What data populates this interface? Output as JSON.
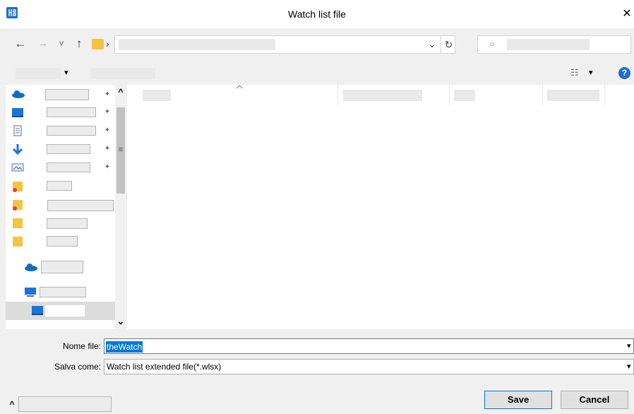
{
  "window": {
    "title": "Watch list file",
    "close_glyph": "✕",
    "app_icon": "app-logo-icon"
  },
  "nav": {
    "back": "←",
    "forward": "→",
    "recent": "˅",
    "up": "↑",
    "crumb_sep": "›",
    "address_dropdown": "⌄",
    "refresh": "↻",
    "search_glyph": "⌕"
  },
  "toolbar": {
    "view_glyph": "☷",
    "dropdown_caret": "▾",
    "help_glyph": "?"
  },
  "form": {
    "filename_label": "Nome file:",
    "filename_value": "theWatch",
    "savetype_label": "Salva come:",
    "savetype_value": "Watch list extended file(*.wlsx)",
    "dropdown_caret": "▾"
  },
  "buttons": {
    "save": "Save",
    "cancel": "Cancel",
    "hide_folders": "^"
  },
  "scroll": {
    "up": "^",
    "down": "⌄",
    "grip": "≡"
  },
  "colors": {
    "accent": "#0078d7",
    "selection_bg": "#0078d7",
    "onedrive": "#0f6cbd",
    "folder": "#f5c443"
  }
}
